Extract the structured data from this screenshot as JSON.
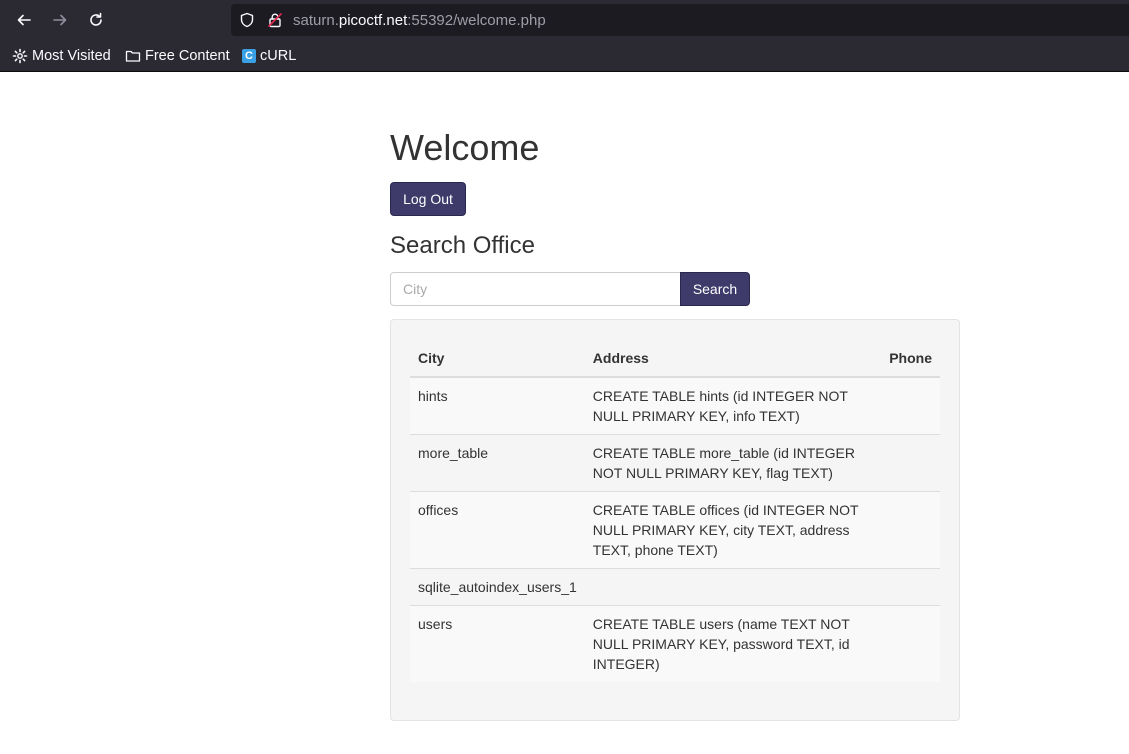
{
  "browser": {
    "url_prefix": "saturn.",
    "url_host": "picoctf.net",
    "url_suffix": ":55392/welcome.php",
    "bookmarks": [
      {
        "label": "Most Visited",
        "icon": "gear-icon"
      },
      {
        "label": "Free Content",
        "icon": "folder-icon"
      },
      {
        "label": "cURL",
        "icon": "curl-icon"
      }
    ]
  },
  "page": {
    "title": "Welcome",
    "logout_label": "Log Out",
    "search_heading": "Search Office",
    "search_placeholder": "City",
    "search_button": "Search"
  },
  "table": {
    "headers": [
      "City",
      "Address",
      "Phone"
    ],
    "rows": [
      {
        "city": "hints",
        "address": "CREATE TABLE hints (id INTEGER NOT NULL PRIMARY KEY, info TEXT)",
        "phone": ""
      },
      {
        "city": "more_table",
        "address": "CREATE TABLE more_table (id INTEGER NOT NULL PRIMARY KEY, flag TEXT)",
        "phone": ""
      },
      {
        "city": "offices",
        "address": "CREATE TABLE offices (id INTEGER NOT NULL PRIMARY KEY, city TEXT, address TEXT, phone TEXT)",
        "phone": ""
      },
      {
        "city": "sqlite_autoindex_users_1",
        "address": "",
        "phone": ""
      },
      {
        "city": "users",
        "address": "CREATE TABLE users (name TEXT NOT NULL PRIMARY KEY, password TEXT, id INTEGER)",
        "phone": ""
      }
    ]
  },
  "colors": {
    "primary_button": "#3e3a6a",
    "chrome_bg": "#2b2a33"
  }
}
